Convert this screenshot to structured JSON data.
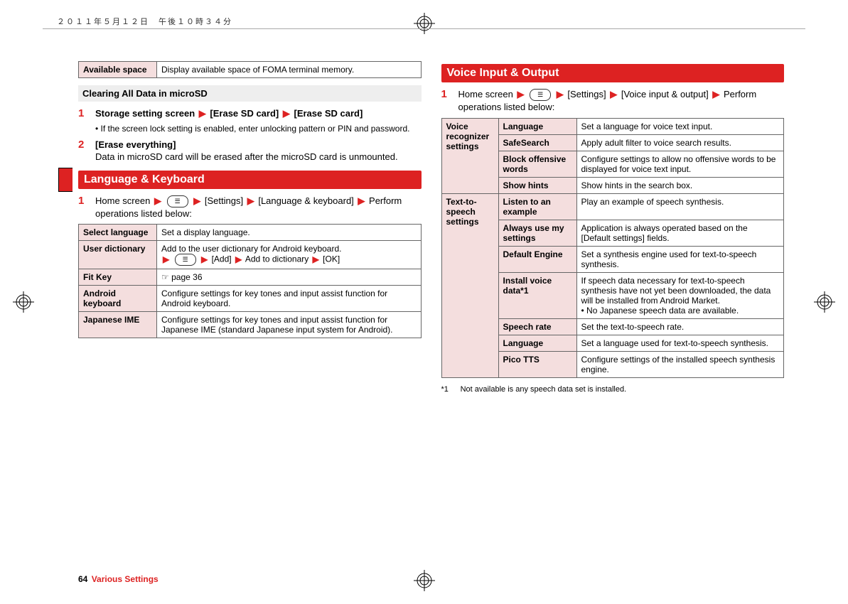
{
  "header_stamp": "２０１１年５月１２日　午後１０時３４分",
  "left": {
    "table1": {
      "rows": [
        {
          "label": "Available space",
          "desc": "Display available space of FOMA terminal memory."
        }
      ]
    },
    "subheading": "Clearing All Data in microSD",
    "step1": {
      "num": "1",
      "bold1": "Storage setting screen",
      "bold2": "[Erase SD card]",
      "bold3": "[Erase SD card]",
      "bullet": "• If the screen lock setting is enabled, enter unlocking pattern or PIN and password."
    },
    "step2": {
      "num": "2",
      "bold1": "[Erase everything]",
      "desc": "Data in microSD card will be erased after the microSD card is unmounted."
    },
    "section_title": "Language & Keyboard",
    "stepA": {
      "num": "1",
      "line1a": "Home screen",
      "line1b": "[Settings]",
      "line1c": "[Language & keyboard]",
      "line1d": "Perform operations listed below:"
    },
    "table2": {
      "rows": [
        {
          "label": "Select language",
          "desc": "Set a display language."
        },
        {
          "label": "User dictionary",
          "desc_pre": "Add to the user dictionary for Android keyboard.",
          "desc_seq": [
            "[Add]",
            "Add to dictionary",
            "[OK]"
          ]
        },
        {
          "label": "Fit Key",
          "desc_ref": "page 36"
        },
        {
          "label": "Android keyboard",
          "desc": "Configure settings for key tones and input assist function for Android keyboard."
        },
        {
          "label": "Japanese IME",
          "desc": "Configure settings for key tones and input assist function for Japanese IME (standard Japanese input system for Android)."
        }
      ]
    }
  },
  "right": {
    "section_title": "Voice Input & Output",
    "stepA": {
      "num": "1",
      "line1a": "Home screen",
      "line1b": "[Settings]",
      "line1c": "[Voice input & output]",
      "line1d": "Perform operations listed below:"
    },
    "group1": {
      "group_label": "Voice recognizer settings",
      "rows": [
        {
          "label": "Language",
          "desc": "Set a language for voice text input."
        },
        {
          "label": "SafeSearch",
          "desc": "Apply adult filter to voice search results."
        },
        {
          "label": "Block offensive words",
          "desc": "Configure settings to allow no offensive words to be displayed for voice text input."
        },
        {
          "label": "Show hints",
          "desc": "Show hints in the search box."
        }
      ]
    },
    "group2": {
      "group_label": "Text-to-speech settings",
      "rows": [
        {
          "label": "Listen to an example",
          "desc": "Play an example of speech synthesis."
        },
        {
          "label": "Always use my settings",
          "desc": "Application is always operated based on the [Default settings] fields."
        },
        {
          "label": "Default Engine",
          "desc": "Set a synthesis engine used for text-to-speech synthesis."
        },
        {
          "label": "Install voice data*1",
          "desc": "If speech data necessary for text-to-speech synthesis have not yet been downloaded, the data will be installed from Android Market.\n• No Japanese speech data are available."
        },
        {
          "label": "Speech rate",
          "desc": "Set the text-to-speech rate."
        },
        {
          "label": "Language",
          "desc": "Set a language used for text-to-speech synthesis."
        },
        {
          "label": "Pico TTS",
          "desc": "Configure settings of the installed speech synthesis engine."
        }
      ]
    },
    "footnote": {
      "mark": "*1",
      "text": "Not available is any speech data set is installed."
    }
  },
  "footer": {
    "page": "64",
    "section": "Various Settings"
  }
}
